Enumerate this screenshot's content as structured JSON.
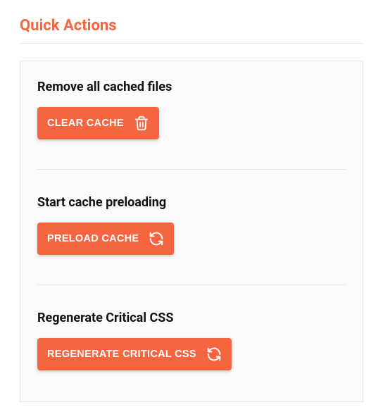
{
  "title": "Quick Actions",
  "actions": [
    {
      "heading": "Remove all cached files",
      "button_label": "CLEAR CACHE",
      "icon": "trash-icon"
    },
    {
      "heading": "Start cache preloading",
      "button_label": "PRELOAD CACHE",
      "icon": "refresh-icon"
    },
    {
      "heading": "Regenerate Critical CSS",
      "button_label": "REGENERATE CRITICAL CSS",
      "icon": "refresh-icon"
    }
  ],
  "colors": {
    "accent": "#f56640"
  }
}
